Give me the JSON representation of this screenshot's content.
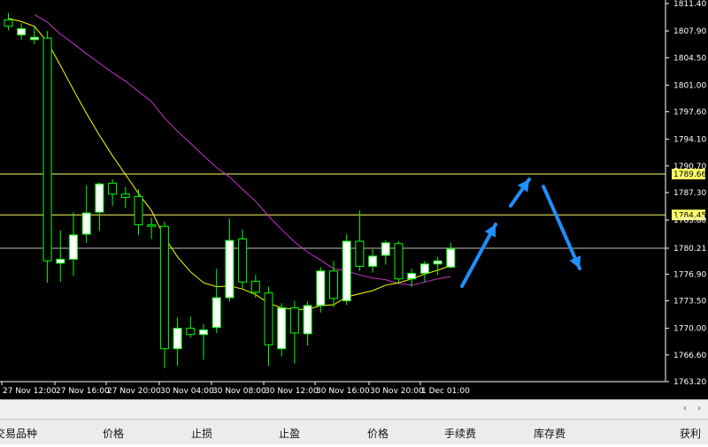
{
  "chart_data": {
    "type": "candlestick",
    "y_ticks": [
      "1811.40",
      "1807.90",
      "1804.50",
      "1801.00",
      "1797.60",
      "1794.10",
      "1790.70",
      "1787.30",
      "1783.80",
      "1780.21",
      "1776.90",
      "1773.50",
      "1770.00",
      "1766.60",
      "1763.20"
    ],
    "y_tick_values": [
      1811.4,
      1807.9,
      1804.5,
      1801.0,
      1797.6,
      1794.1,
      1790.7,
      1787.3,
      1783.8,
      1780.21,
      1776.9,
      1773.5,
      1770.0,
      1766.6,
      1763.2
    ],
    "x_labels": [
      "27 Nov 12:00",
      "27 Nov 16:00",
      "27 Nov 20:00",
      "30 Nov 04:00",
      "30 Nov 08:00",
      "30 Nov 12:00",
      "30 Nov 16:00",
      "30 Nov 20:00",
      "1 Dec 01:00"
    ],
    "ylim": [
      1762.0,
      1812.5
    ],
    "horizontal_levels": [
      {
        "label": "1789.66",
        "value": 1789.66,
        "color": "#ffff66"
      },
      {
        "label": "1784.45",
        "value": 1784.45,
        "color": "#ffff66"
      },
      {
        "label": "1780.21",
        "value": 1780.21,
        "color": "#c0c0c0"
      }
    ],
    "candles": [
      {
        "o": 1809.3,
        "h": 1810.2,
        "l": 1808.0,
        "c": 1808.5
      },
      {
        "o": 1807.4,
        "h": 1808.9,
        "l": 1806.8,
        "c": 1808.2
      },
      {
        "o": 1806.8,
        "h": 1808.6,
        "l": 1806.2,
        "c": 1807.1
      },
      {
        "o": 1807.0,
        "h": 1807.9,
        "l": 1775.8,
        "c": 1778.6
      },
      {
        "o": 1778.3,
        "h": 1782.5,
        "l": 1775.9,
        "c": 1778.8
      },
      {
        "o": 1778.8,
        "h": 1784.8,
        "l": 1776.7,
        "c": 1781.9
      },
      {
        "o": 1782.0,
        "h": 1788.2,
        "l": 1780.9,
        "c": 1784.7
      },
      {
        "o": 1784.8,
        "h": 1788.6,
        "l": 1782.4,
        "c": 1788.4
      },
      {
        "o": 1788.5,
        "h": 1789.0,
        "l": 1785.6,
        "c": 1787.1
      },
      {
        "o": 1787.1,
        "h": 1788.0,
        "l": 1785.3,
        "c": 1786.7
      },
      {
        "o": 1786.8,
        "h": 1787.7,
        "l": 1781.9,
        "c": 1783.2
      },
      {
        "o": 1783.2,
        "h": 1784.1,
        "l": 1781.4,
        "c": 1783.0
      },
      {
        "o": 1783.0,
        "h": 1783.6,
        "l": 1764.9,
        "c": 1767.4
      },
      {
        "o": 1767.4,
        "h": 1771.4,
        "l": 1765.2,
        "c": 1770.0
      },
      {
        "o": 1770.0,
        "h": 1771.5,
        "l": 1768.8,
        "c": 1769.2
      },
      {
        "o": 1769.2,
        "h": 1770.5,
        "l": 1766.0,
        "c": 1769.8
      },
      {
        "o": 1770.1,
        "h": 1777.6,
        "l": 1769.4,
        "c": 1773.9
      },
      {
        "o": 1773.9,
        "h": 1784.0,
        "l": 1773.4,
        "c": 1781.2
      },
      {
        "o": 1781.4,
        "h": 1782.6,
        "l": 1775.1,
        "c": 1775.9
      },
      {
        "o": 1776.0,
        "h": 1776.8,
        "l": 1773.9,
        "c": 1774.6
      },
      {
        "o": 1774.5,
        "h": 1775.3,
        "l": 1765.2,
        "c": 1767.9
      },
      {
        "o": 1767.4,
        "h": 1773.2,
        "l": 1766.4,
        "c": 1772.6
      },
      {
        "o": 1772.6,
        "h": 1773.5,
        "l": 1765.5,
        "c": 1769.4
      },
      {
        "o": 1769.3,
        "h": 1773.4,
        "l": 1767.8,
        "c": 1772.9
      },
      {
        "o": 1772.9,
        "h": 1777.8,
        "l": 1772.0,
        "c": 1777.3
      },
      {
        "o": 1777.3,
        "h": 1778.6,
        "l": 1772.7,
        "c": 1773.8
      },
      {
        "o": 1773.5,
        "h": 1782.0,
        "l": 1773.0,
        "c": 1781.1
      },
      {
        "o": 1781.1,
        "h": 1785.0,
        "l": 1777.3,
        "c": 1777.9
      },
      {
        "o": 1777.9,
        "h": 1780.1,
        "l": 1777.1,
        "c": 1779.2
      },
      {
        "o": 1779.3,
        "h": 1781.2,
        "l": 1778.1,
        "c": 1780.9
      },
      {
        "o": 1780.8,
        "h": 1781.1,
        "l": 1775.7,
        "c": 1776.3
      },
      {
        "o": 1776.3,
        "h": 1777.6,
        "l": 1775.3,
        "c": 1777.0
      },
      {
        "o": 1777.0,
        "h": 1778.6,
        "l": 1775.9,
        "c": 1778.2
      },
      {
        "o": 1778.2,
        "h": 1779.1,
        "l": 1776.8,
        "c": 1778.6
      },
      {
        "o": 1777.8,
        "h": 1780.9,
        "l": 1777.6,
        "c": 1780.1
      }
    ],
    "ma_fast": [
      1809.5,
      1809.1,
      1808.5,
      1806.5,
      1803.5,
      1800.4,
      1797.4,
      1794.6,
      1792.0,
      1789.6,
      1787.2,
      1785.0,
      1781.6,
      1779.1,
      1777.2,
      1775.8,
      1775.3,
      1775.4,
      1775.0,
      1774.3,
      1773.2,
      1772.6,
      1772.4,
      1772.4,
      1772.9,
      1773.0,
      1774.0,
      1774.4,
      1774.8,
      1775.5,
      1775.8,
      1776.3,
      1776.9,
      1777.4,
      1778.0
    ],
    "ma_slow": [
      null,
      null,
      1810.0,
      1809.0,
      1807.5,
      1806.3,
      1805.0,
      1803.8,
      1802.6,
      1801.5,
      1800.2,
      1798.9,
      1796.8,
      1795.1,
      1793.6,
      1792.0,
      1790.5,
      1789.3,
      1787.7,
      1786.2,
      1784.3,
      1782.6,
      1781.0,
      1779.7,
      1778.7,
      1777.6,
      1777.3,
      1776.8,
      1776.4,
      1776.2,
      1775.7,
      1775.5,
      1775.9,
      1776.3,
      1776.6
    ]
  },
  "table_header": {
    "symbol": "交易品种",
    "price": "价格",
    "stop_loss": "止损",
    "take_profit": "止盈",
    "price2": "价格",
    "commission": "手续费",
    "swap": "库存费",
    "profit": "获利"
  },
  "scroll": {
    "left_arrow": "‹",
    "right_arrow": "›"
  },
  "colors": {
    "background": "#000000",
    "bull_body": "#ffffff",
    "candle_outline": "#00ff00",
    "ma_fast": "#ffff00",
    "ma_slow": "#cc33cc",
    "arrow": "#1e90ff"
  }
}
